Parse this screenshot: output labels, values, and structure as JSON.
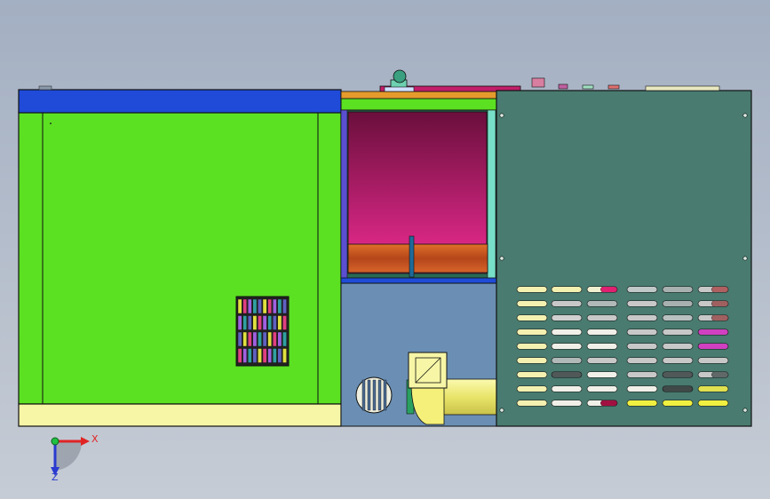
{
  "colors": {
    "background_top": "#a3afc2",
    "background_bottom": "#c6ccd5",
    "left_cabinet": "#5ce022",
    "cabinet_top_bar": "#1f4bd8",
    "cabinet_base": "#f6f6a6",
    "chamber_top": "#6a0f3c",
    "chamber_bottom": "#f02c94",
    "heater_tube": "#c9531c",
    "lower_panel": "#6b8fb4",
    "right_panel": "#497b70",
    "fan_yellow": "#f4f07a",
    "outline": "#111111"
  },
  "triad": {
    "x_label": "X",
    "z_label": "Z",
    "x_color": "#e02424",
    "z_color": "#2a3ad0",
    "y_color": "#20c040"
  },
  "vents": {
    "rows": 9,
    "columns": 6
  }
}
